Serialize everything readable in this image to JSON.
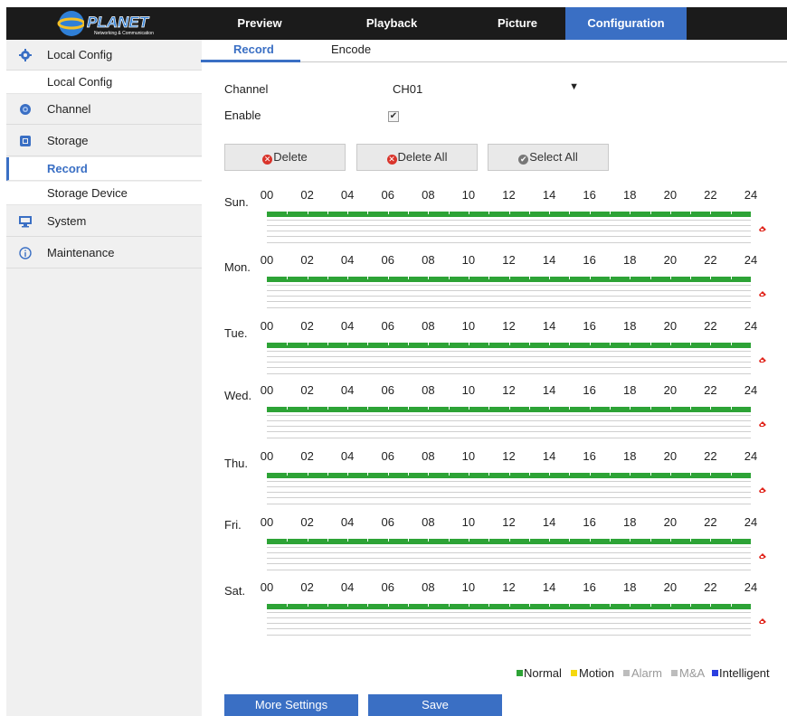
{
  "header": {
    "logo_text": "PLANET",
    "logo_sub": "Networking & Communication",
    "tabs": [
      {
        "label": "Preview"
      },
      {
        "label": "Playback"
      },
      {
        "label": "Picture"
      },
      {
        "label": "Configuration"
      }
    ],
    "active_tab": "Configuration",
    "active_color": "#3a6fc4"
  },
  "sidebar": {
    "groups": [
      {
        "label": "Local Config",
        "icon": "gear-icon"
      },
      {
        "label": "Channel",
        "icon": "camera-lens-icon"
      },
      {
        "label": "Storage",
        "icon": "storage-icon"
      },
      {
        "label": "System",
        "icon": "monitor-icon"
      },
      {
        "label": "Maintenance",
        "icon": "info-icon"
      }
    ],
    "subitems": {
      "local_config": "Local Config",
      "record": "Record",
      "storage_device": "Storage Device"
    },
    "active_item": "Record"
  },
  "subtabs": [
    {
      "label": "Record"
    },
    {
      "label": "Encode"
    }
  ],
  "form": {
    "channel_label": "Channel",
    "channel_value": "CH01",
    "enable_label": "Enable",
    "enable_checked": true
  },
  "buttons": {
    "delete": "Delete",
    "delete_all": "Delete All",
    "select_all": "Select All",
    "more_settings": "More Settings",
    "save": "Save"
  },
  "schedule": {
    "days": [
      "Sun.",
      "Mon.",
      "Tue.",
      "Wed.",
      "Thu.",
      "Fri.",
      "Sat."
    ],
    "hours": [
      "00",
      "02",
      "04",
      "06",
      "08",
      "10",
      "12",
      "14",
      "16",
      "18",
      "20",
      "22",
      "24"
    ],
    "recording_type": "Normal",
    "recording_span": [
      "00",
      "24"
    ]
  },
  "legend": [
    {
      "label": "Normal",
      "color": "#2da336"
    },
    {
      "label": "Motion",
      "color": "#f5d80f"
    },
    {
      "label": "Alarm",
      "color": "#bdbdbd"
    },
    {
      "label": "M&A",
      "color": "#bdbdbd"
    },
    {
      "label": "Intelligent",
      "color": "#2b3fe0"
    }
  ]
}
